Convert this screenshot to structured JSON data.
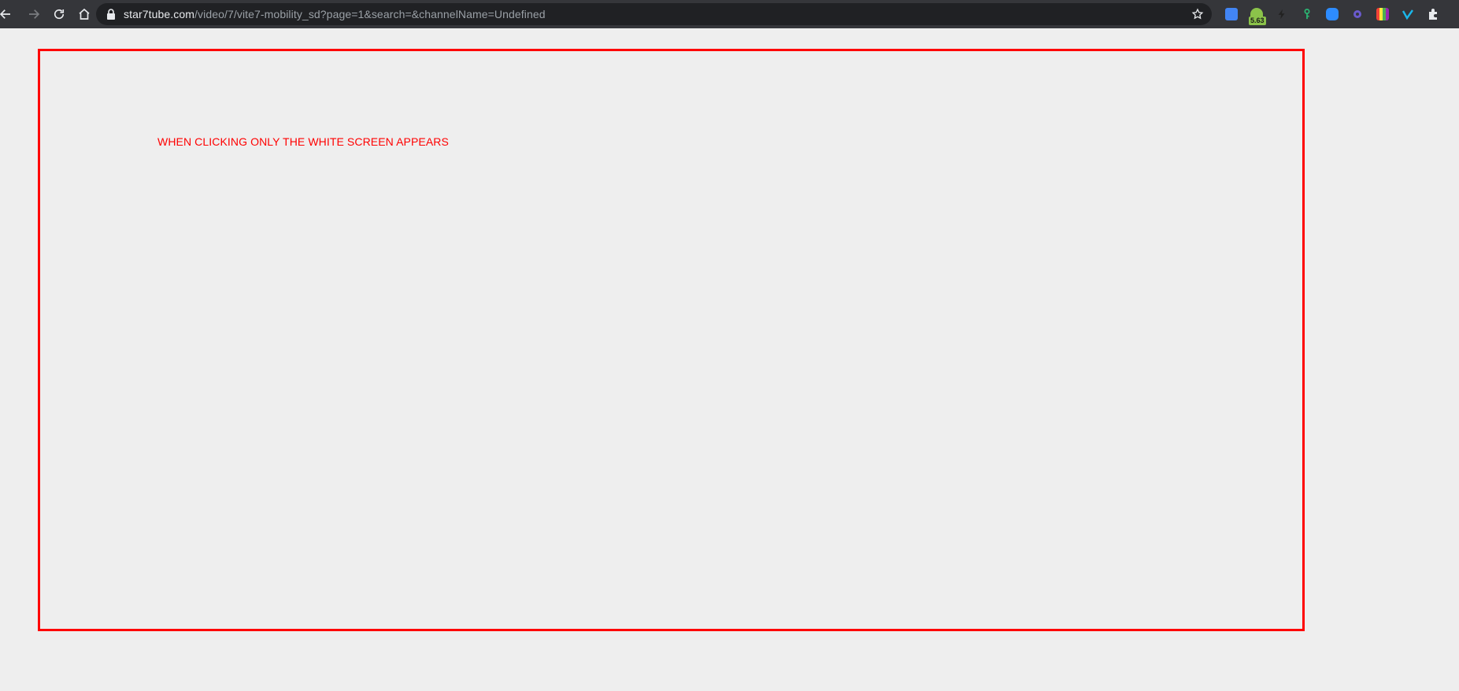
{
  "browser": {
    "url_host": "star7tube.com",
    "url_path": "/video/7/vite7-mobility_sd?page=1&search=&channelName=Undefined",
    "nav": {
      "back_icon": "back-arrow-icon",
      "forward_icon": "forward-arrow-icon",
      "reload_icon": "reload-icon",
      "home_icon": "home-icon"
    },
    "bookmark_icon": "star-icon",
    "extensions": [
      {
        "name": "translate-extension-icon",
        "color": "#4285f4"
      },
      {
        "name": "android-extension-icon",
        "color": "#8bc34a",
        "badge": "5.63"
      },
      {
        "name": "bolt-extension-icon",
        "color": "#3c3c3c"
      },
      {
        "name": "key-extension-icon",
        "color": "#2bb673"
      },
      {
        "name": "zoom-extension-icon",
        "color": "#2d8cff"
      },
      {
        "name": "gear-extension-icon",
        "color": "#6a5acd"
      },
      {
        "name": "palette-extension-icon",
        "color": "#ff9800"
      },
      {
        "name": "vimeo-extension-icon",
        "color": "#1ab7ea"
      },
      {
        "name": "puzzle-extension-icon",
        "color": "#e8eaed"
      }
    ]
  },
  "page": {
    "annotation_text": "WHEN CLICKING ONLY THE WHITE SCREEN APPEARS",
    "frame_color": "#ff0000",
    "background": "#eeeeee"
  }
}
